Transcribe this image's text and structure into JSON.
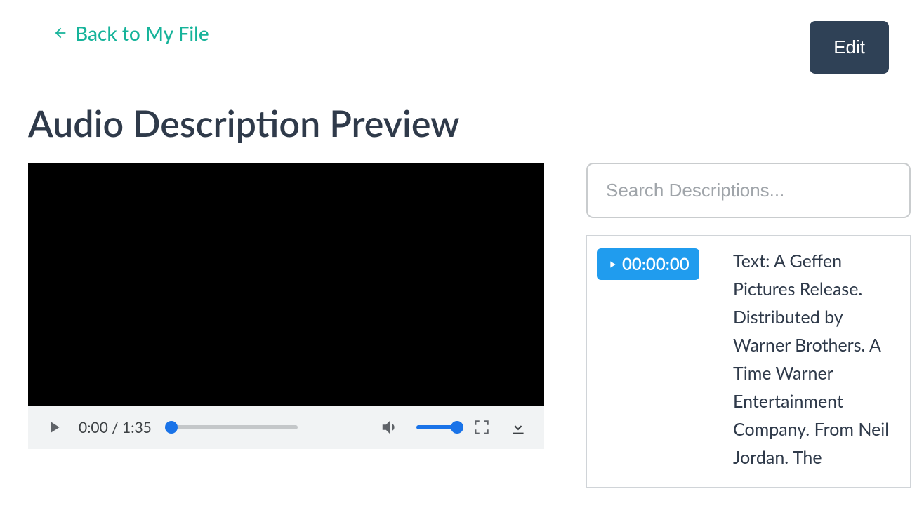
{
  "nav": {
    "back_label": "Back to My File",
    "edit_label": "Edit"
  },
  "page": {
    "title": "Audio Description Preview"
  },
  "player": {
    "time_display": "0:00 / 1:35",
    "seek_progress_pct": 0,
    "volume_pct": 100
  },
  "search": {
    "placeholder": "Search Descriptions..."
  },
  "descriptions": [
    {
      "timestamp": "00:00:00",
      "text": "Text: A Geffen Pictures Release. Distributed by Warner Brothers. A Time Warner Entertainment Company. From Neil Jordan. The"
    }
  ]
}
